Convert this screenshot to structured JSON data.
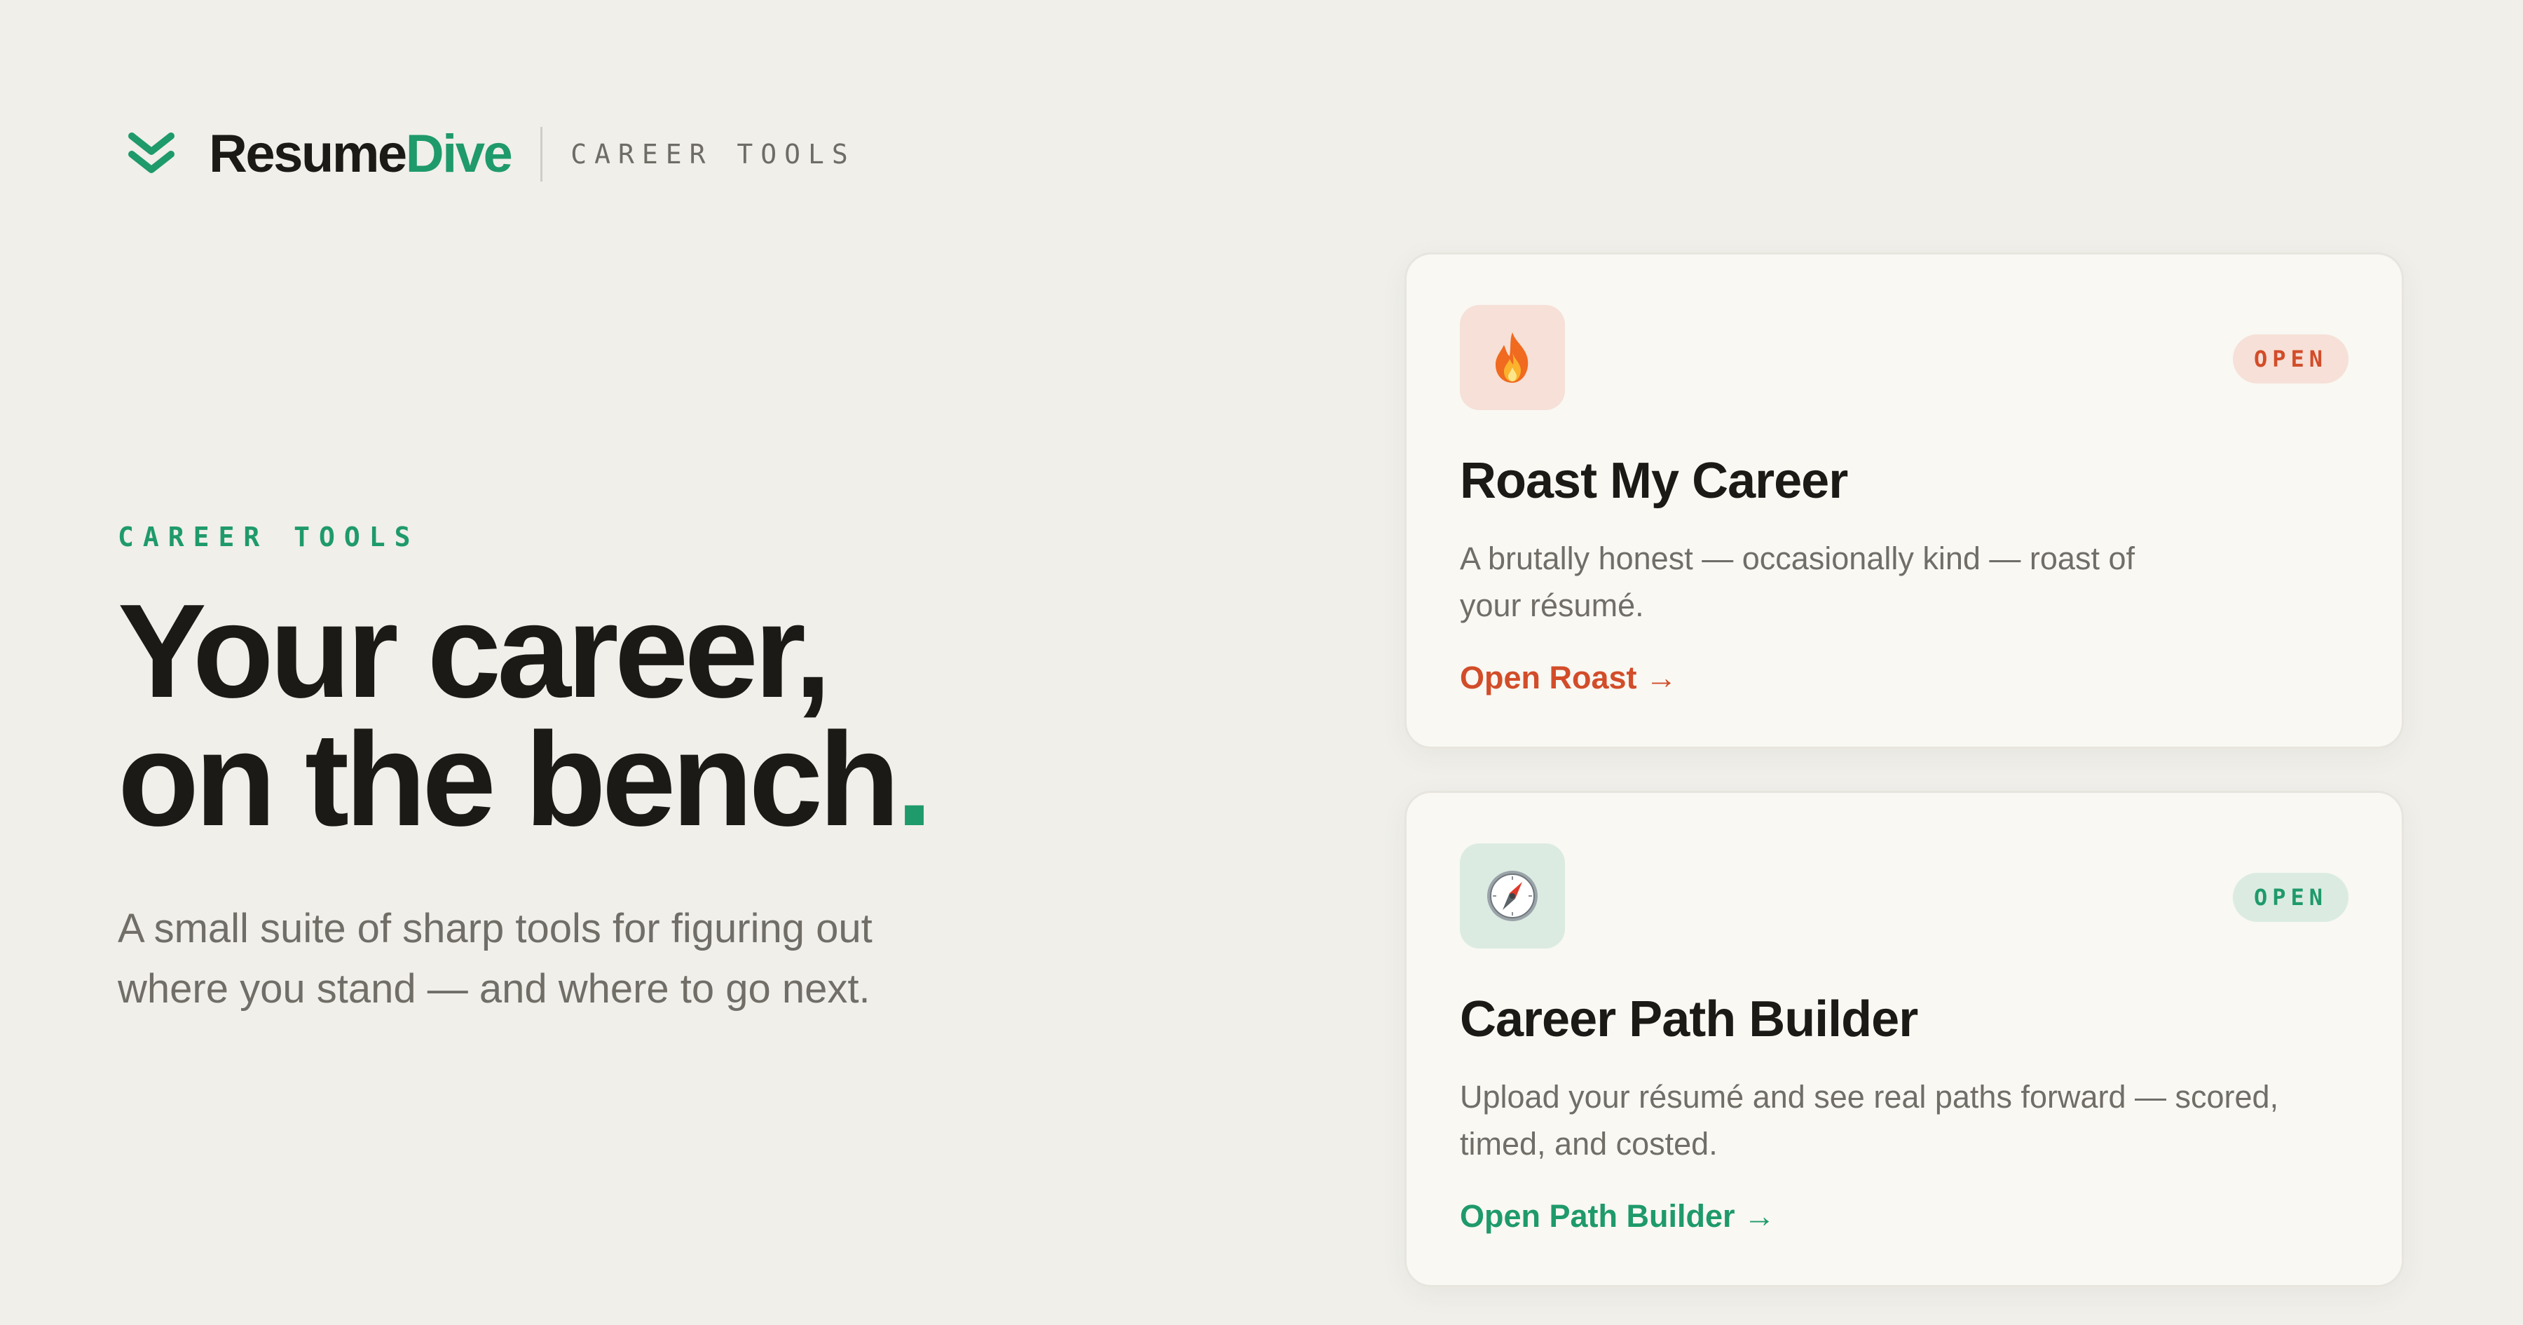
{
  "header": {
    "brand_primary": "Resume",
    "brand_accent": "Dive",
    "tag": "CAREER TOOLS",
    "logo_icon": "double-chevron-down-icon"
  },
  "hero": {
    "eyebrow": "CAREER TOOLS",
    "headline_line1": "Your career,",
    "headline_line2": "on the bench",
    "headline_dot": ".",
    "subhead_line1": "A small suite of sharp tools for figuring out",
    "subhead_line2": "where you stand — and where to go next."
  },
  "tools": [
    {
      "icon": "fire-icon",
      "badge": "OPEN",
      "title": "Roast My Career",
      "description_line1": "A brutally honest — occasionally kind — roast of",
      "description_line2": "your résumé.",
      "link": "Open Roast →",
      "accent": "#d24d29"
    },
    {
      "icon": "compass-icon",
      "badge": "OPEN",
      "title": "Career Path Builder",
      "description_line1": "Upload your résumé and see real paths forward — scored,",
      "description_line2": "timed, and costed.",
      "link": "Open Path Builder →",
      "accent": "#1f9a6a"
    }
  ],
  "colors": {
    "background": "#f0efea",
    "brand_green": "#1f9a6a",
    "roast_orange": "#d24d29",
    "text_dark": "#1b1a16",
    "text_muted": "#706e67"
  }
}
